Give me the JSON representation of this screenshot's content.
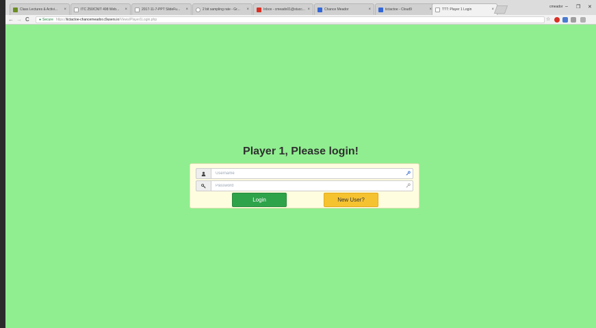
{
  "browser": {
    "tabs": [
      {
        "label": "Class Lectures & Activi...",
        "favicon_color": "#6b8e23"
      },
      {
        "label": "ITC 250/CNIT 498 Web...",
        "favicon_color": "#9e9e9e"
      },
      {
        "label": "2017-11-7-PPT SlideFu...",
        "favicon_color": "#9e9e9e"
      },
      {
        "label": "2 bit sampling rate - Gr...",
        "favicon_color": "#9e9e9e"
      },
      {
        "label": "Inbox - cmeado01@stucc...",
        "favicon_color": "#d93025"
      },
      {
        "label": "Chance Meador",
        "favicon_color": "#3367d6"
      },
      {
        "label": "tictactoe - Cloud9",
        "favicon_color": "#3367d6"
      },
      {
        "label": "TTT: Player 1 Login",
        "favicon_color": "#9e9e9e"
      }
    ],
    "tab_close": "×",
    "user_name": "cmeador",
    "window_minimize": "–",
    "window_restore": "❐",
    "window_close": "✕",
    "back": "←",
    "forward": "→",
    "reload": "C",
    "secure_label": "Secure",
    "url_scheme": "https://",
    "url_host": "tictactoe-chancemeador.c9users.io",
    "url_path": "/Views/Player1Login.php",
    "star": "☆"
  },
  "page": {
    "background": "#90ee90",
    "heading": "Player 1, Please login!",
    "username_placeholder": "Username",
    "password_placeholder": "Password",
    "login_button": "Login",
    "new_user_button": "New User?"
  }
}
